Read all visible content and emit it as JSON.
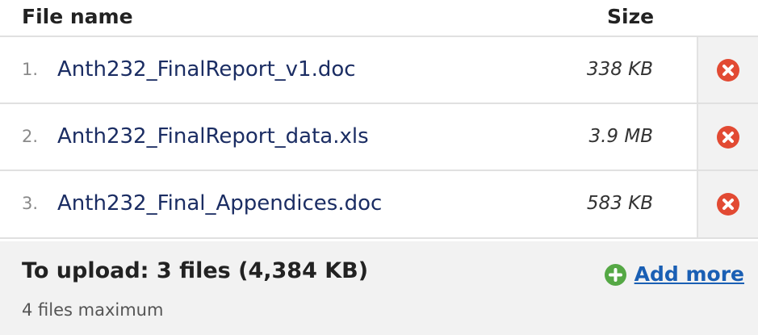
{
  "header": {
    "file_name_label": "File name",
    "size_label": "Size"
  },
  "files": [
    {
      "index": "1.",
      "name": "Anth232_FinalReport_v1.doc",
      "size": "338 KB",
      "remove_icon": "remove-icon"
    },
    {
      "index": "2.",
      "name": "Anth232_FinalReport_data.xls",
      "size": "3.9 MB",
      "remove_icon": "remove-icon"
    },
    {
      "index": "3.",
      "name": "Anth232_Final_Appendices.doc",
      "size": "583 KB",
      "remove_icon": "remove-icon"
    }
  ],
  "footer": {
    "summary": "To upload: 3 files (4,384 KB)",
    "max_note": "4 files maximum",
    "add_more_label": "Add more",
    "add_icon": "plus-circle-icon"
  },
  "colors": {
    "remove": "#e24a33",
    "add": "#55a845",
    "link": "#1a5fb4",
    "file_name": "#1b2d63"
  }
}
